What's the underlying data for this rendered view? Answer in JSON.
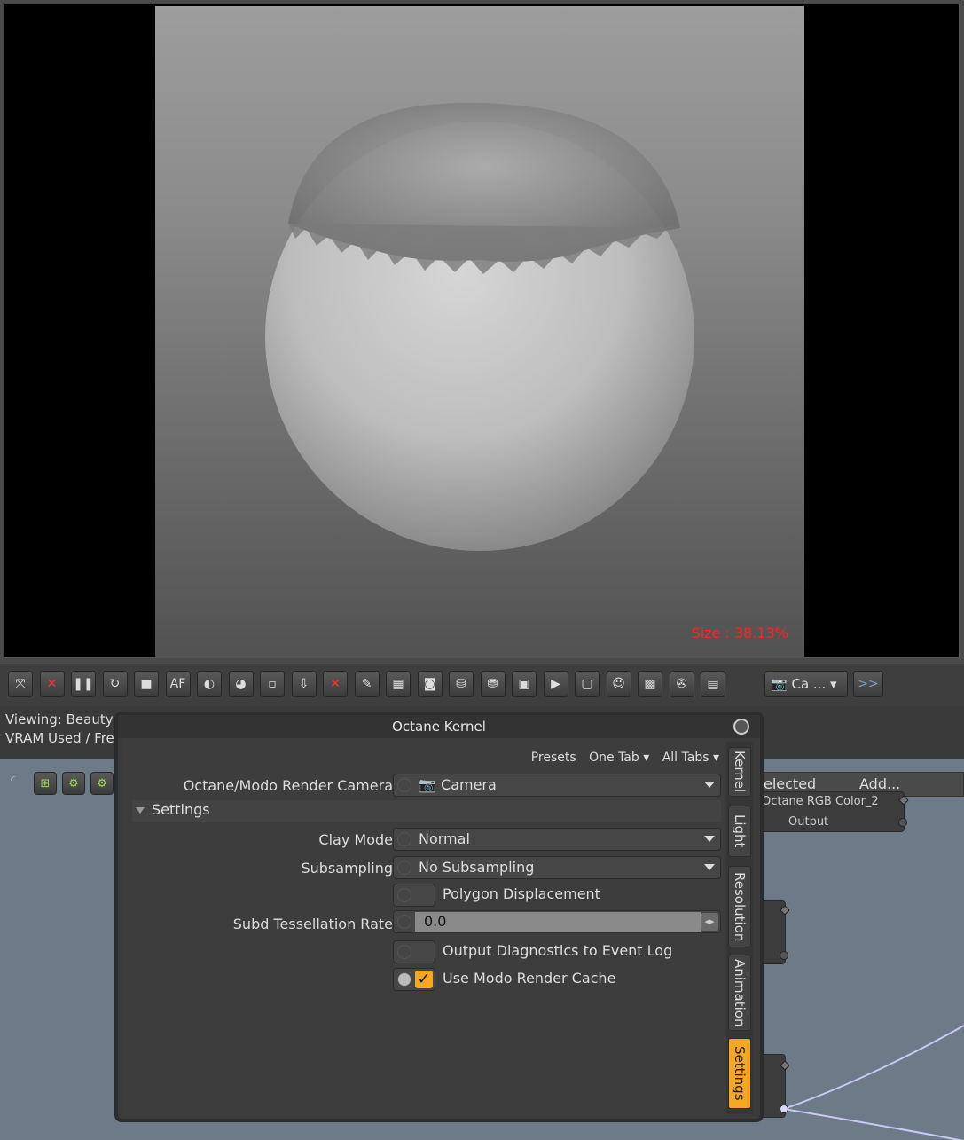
{
  "viewport": {
    "size_label": "Size : 38.13%"
  },
  "toolbar": {
    "buttons": [
      {
        "name": "fit-icon",
        "glyph": "⤧"
      },
      {
        "name": "stop-render-icon",
        "glyph": "✕"
      },
      {
        "name": "pause-icon",
        "glyph": "❚❚"
      },
      {
        "name": "restart-icon",
        "glyph": "↻"
      },
      {
        "name": "stop-icon",
        "glyph": "■"
      },
      {
        "name": "autofocus-icon",
        "glyph": "AF"
      },
      {
        "name": "material-picker-icon",
        "glyph": "◐"
      },
      {
        "name": "color-picker-icon",
        "glyph": "◕"
      },
      {
        "name": "region-icon",
        "glyph": "▫"
      },
      {
        "name": "export-icon",
        "glyph": "⇩"
      },
      {
        "name": "clear-icon",
        "glyph": "✕"
      },
      {
        "name": "pick-focus-icon",
        "glyph": "✎"
      },
      {
        "name": "denoise-icon",
        "glyph": "▦"
      },
      {
        "name": "snapshot-icon",
        "glyph": "◙"
      },
      {
        "name": "save-image-icon",
        "glyph": "⛁"
      },
      {
        "name": "save-all-icon",
        "glyph": "⛃"
      },
      {
        "name": "cube-icon",
        "glyph": "▣"
      },
      {
        "name": "console-icon",
        "glyph": "▶"
      },
      {
        "name": "frame-icon",
        "glyph": "▢"
      },
      {
        "name": "portrait-icon",
        "glyph": "☺"
      },
      {
        "name": "checker-icon",
        "glyph": "▩"
      },
      {
        "name": "film-reel-icon",
        "glyph": "✇"
      },
      {
        "name": "document-icon",
        "glyph": "▤"
      }
    ],
    "camera_dropdown": "Ca ...",
    "more_label": ">>"
  },
  "status": {
    "line1": "Viewing: Beauty",
    "line2": "VRAM Used / Fre"
  },
  "node_editor": {
    "tab_selected": "elected",
    "tab_add": "Add...",
    "node_title": "Octane RGB Color_2",
    "node_output": "Output"
  },
  "dialog": {
    "title": "Octane Kernel",
    "presets": "Presets",
    "one_tab": "One Tab",
    "all_tabs": "All Tabs",
    "camera_label": "Octane/Modo Render Camera",
    "camera_value": "Camera",
    "settings_header": "Settings",
    "clay_mode_label": "Clay Mode",
    "clay_mode_value": "Normal",
    "subsampling_label": "Subsampling",
    "subsampling_value": "No Subsampling",
    "polygon_displacement": "Polygon Displacement",
    "subd_tess_label": "Subd Tessellation Rate",
    "subd_tess_value": "0.0",
    "output_diagnostics": "Output Diagnostics to Event Log",
    "use_render_cache": "Use Modo Render Cache",
    "side_tabs": [
      "Kernel",
      "Light",
      "Resolution",
      "Animation",
      "Settings"
    ]
  }
}
